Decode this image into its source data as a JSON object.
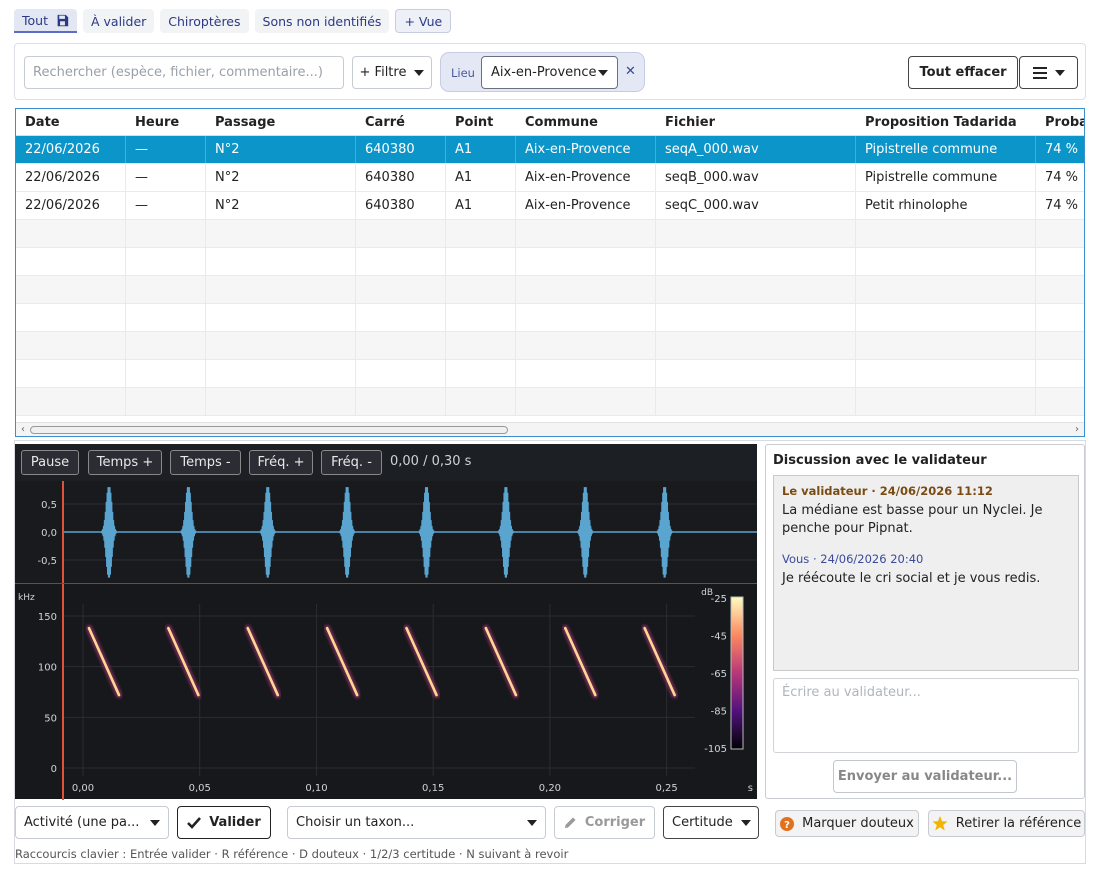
{
  "tabs": [
    {
      "label": "Tout",
      "active": true,
      "save_icon": "save-icon"
    },
    {
      "label": "À valider"
    },
    {
      "label": "Chiroptères"
    },
    {
      "label": "Sons non identifiés"
    },
    {
      "label": "+ Vue"
    }
  ],
  "filter": {
    "search_placeholder": "Rechercher (espèce, fichier, commentaire...)",
    "add_filter_label": "+ Filtre",
    "chip_label": "Lieu",
    "chip_value": "Aix-en-Provence",
    "clear_label": "Tout effacer",
    "menu_icon": "hamburger-icon"
  },
  "table": {
    "columns": [
      "Date",
      "Heure",
      "Passage",
      "Carré",
      "Point",
      "Commune",
      "Fichier",
      "Proposition Tadarida",
      "Proba"
    ],
    "rows": [
      [
        "22/06/2026",
        "—",
        "N°2",
        "640380",
        "A1",
        "Aix-en-Provence",
        "seqA_000.wav",
        "Pipistrelle commune",
        "74 %"
      ],
      [
        "22/06/2026",
        "—",
        "N°2",
        "640380",
        "A1",
        "Aix-en-Provence",
        "seqB_000.wav",
        "Pipistrelle commune",
        "74 %"
      ],
      [
        "22/06/2026",
        "—",
        "N°2",
        "640380",
        "A1",
        "Aix-en-Provence",
        "seqC_000.wav",
        "Petit rhinolophe",
        "74 %"
      ]
    ],
    "selected_row": 0
  },
  "player": {
    "buttons": [
      "Pause",
      "Temps +",
      "Temps -",
      "Fréq. +",
      "Fréq. -"
    ],
    "time": "0,00 / 0,30 s",
    "wave_ticks": [
      "0,5",
      "0,0",
      "-0,5"
    ],
    "freq_unit": "kHz",
    "freq_ticks": [
      "150",
      "100",
      "50",
      "0"
    ],
    "time_ticks": [
      "0,00",
      "0,05",
      "0,10",
      "0,15",
      "0,20",
      "0,25"
    ],
    "time_unit": "s",
    "db_unit": "dB",
    "db_ticks": [
      "-25",
      "-45",
      "-65",
      "-85",
      "-105"
    ],
    "call_times_s": [
      0.0,
      0.034,
      0.068,
      0.102,
      0.136,
      0.17,
      0.204,
      0.238
    ],
    "call_start_khz": 138,
    "call_end_khz": 72
  },
  "discussion": {
    "title": "Discussion avec le validateur",
    "messages": [
      {
        "head": "Le validateur · 24/06/2026 11:12",
        "body": "La médiane est basse pour un Nyclei. Je penche pour Pipnat.",
        "role": "validator"
      },
      {
        "head": "Vous · 24/06/2026 20:40",
        "body": "Je réécoute le cri social et je vous redis.",
        "role": "you"
      }
    ],
    "input_placeholder": "Écrire au validateur...",
    "send_label": "Envoyer au validateur..."
  },
  "bottom": {
    "activity": "Activité (une pa...",
    "validate": "Valider",
    "taxon_placeholder": "Choisir un taxon...",
    "correct": "Corriger",
    "certainty": "Certitude",
    "doubtful": "Marquer douteux",
    "remove_ref": "Retirer la référence",
    "shortcuts": "Raccourcis clavier : Entrée valider · R référence · D douteux · 1/2/3 certitude · N suivant à revoir"
  },
  "colors": {
    "accent": "#0b95c8",
    "chip_bg": "#e4e8f5",
    "wave": "#5aa5cf",
    "cursor": "#e0533a",
    "help_icon": "#e2711d",
    "star_icon": "#f2b400"
  }
}
